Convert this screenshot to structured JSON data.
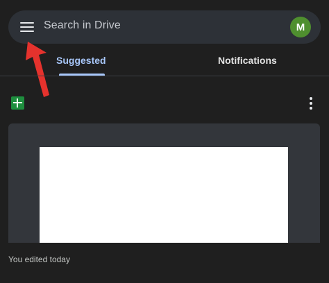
{
  "search": {
    "placeholder": "Search in Drive"
  },
  "account": {
    "avatar_initial": "M"
  },
  "tabs": [
    {
      "label": "Suggested",
      "active": true
    },
    {
      "label": "Notifications",
      "active": false
    }
  ],
  "file": {
    "type_icon": "sheets-icon",
    "edited_text": "You edited today"
  },
  "colors": {
    "background": "#1f1f1f",
    "search_bar": "#2d3137",
    "active_tab": "#a8c7fa",
    "avatar": "#4f8f2f",
    "sheets_icon": "#1e8e3e",
    "annotation_arrow": "#e5322d"
  }
}
